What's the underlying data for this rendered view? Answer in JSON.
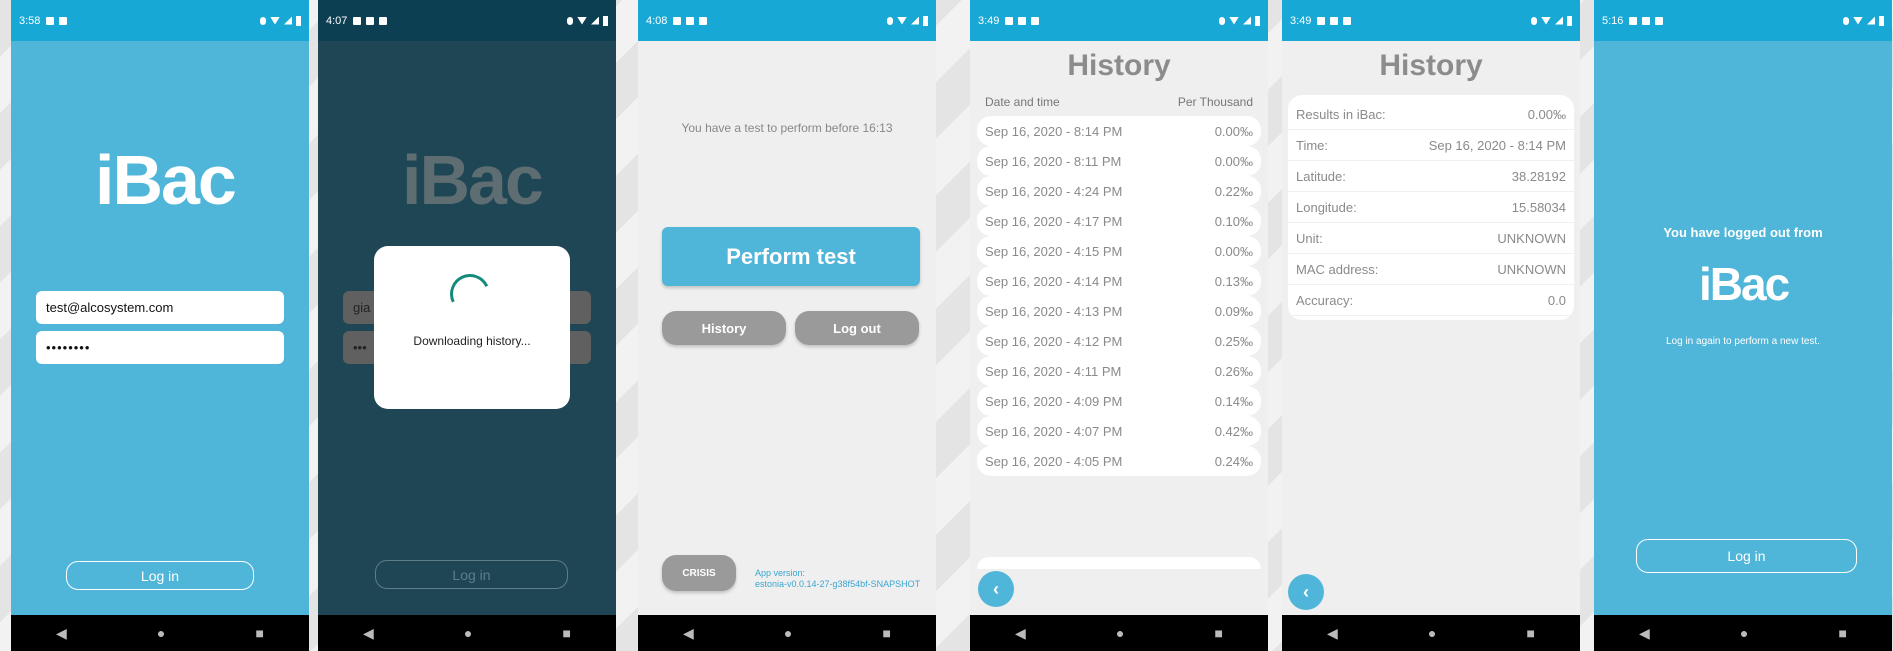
{
  "colors": {
    "accent": "#17a8d6",
    "login_bg": "#4fb5d9",
    "grey_btn": "#9a9a9a"
  },
  "screens": [
    {
      "time": "3:58"
    },
    {
      "time": "4:07"
    },
    {
      "time": "4:08"
    },
    {
      "time": "3:49"
    },
    {
      "time": "3:49"
    },
    {
      "time": "5:16"
    }
  ],
  "login": {
    "logo": "iBac",
    "email": "test@alcosystem.com",
    "password": "••••••••",
    "login_button": "Log in"
  },
  "loading": {
    "logo": "iBac",
    "email_partial": "gia",
    "password_partial": "•••",
    "message": "Downloading history...",
    "login_button": "Log in"
  },
  "home": {
    "notice": "You have a test to perform before 16:13",
    "perform_button": "Perform test",
    "history_button": "History",
    "logout_button": "Log out",
    "crisis_button": "CRISIS",
    "version_label": "App version:",
    "version_value": "estonia-v0.0.14-27-g38f54bf-SNAPSHOT"
  },
  "history": {
    "title": "History",
    "col_date": "Date and time",
    "col_value": "Per Thousand",
    "rows": [
      {
        "date": "Sep 16, 2020 - 8:14 PM",
        "value": "0.00‰"
      },
      {
        "date": "Sep 16, 2020 - 8:11 PM",
        "value": "0.00‰"
      },
      {
        "date": "Sep 16, 2020 - 4:24 PM",
        "value": "0.22‰"
      },
      {
        "date": "Sep 16, 2020 - 4:17 PM",
        "value": "0.10‰"
      },
      {
        "date": "Sep 16, 2020 - 4:15 PM",
        "value": "0.00‰"
      },
      {
        "date": "Sep 16, 2020 - 4:14 PM",
        "value": "0.13‰"
      },
      {
        "date": "Sep 16, 2020 - 4:13 PM",
        "value": "0.09‰"
      },
      {
        "date": "Sep 16, 2020 - 4:12 PM",
        "value": "0.25‰"
      },
      {
        "date": "Sep 16, 2020 - 4:11 PM",
        "value": "0.26‰"
      },
      {
        "date": "Sep 16, 2020 - 4:09 PM",
        "value": "0.14‰"
      },
      {
        "date": "Sep 16, 2020 - 4:07 PM",
        "value": "0.42‰"
      },
      {
        "date": "Sep 16, 2020 - 4:05 PM",
        "value": "0.24‰"
      }
    ]
  },
  "detail": {
    "title": "History",
    "rows": [
      {
        "label": "Results in iBac:",
        "value": "0.00‰"
      },
      {
        "label": "Time:",
        "value": "Sep 16, 2020 - 8:14 PM"
      },
      {
        "label": "Latitude:",
        "value": "38.28192"
      },
      {
        "label": "Longitude:",
        "value": "15.58034"
      },
      {
        "label": "Unit:",
        "value": "UNKNOWN"
      },
      {
        "label": "MAC address:",
        "value": "UNKNOWN"
      },
      {
        "label": "Accuracy:",
        "value": "0.0"
      }
    ]
  },
  "logout": {
    "message": "You have logged out from",
    "logo": "iBac",
    "sub": "Log in again to perform a new test.",
    "login_button": "Log in"
  },
  "nav": {
    "back": "◀",
    "home": "●",
    "recent": "■"
  }
}
